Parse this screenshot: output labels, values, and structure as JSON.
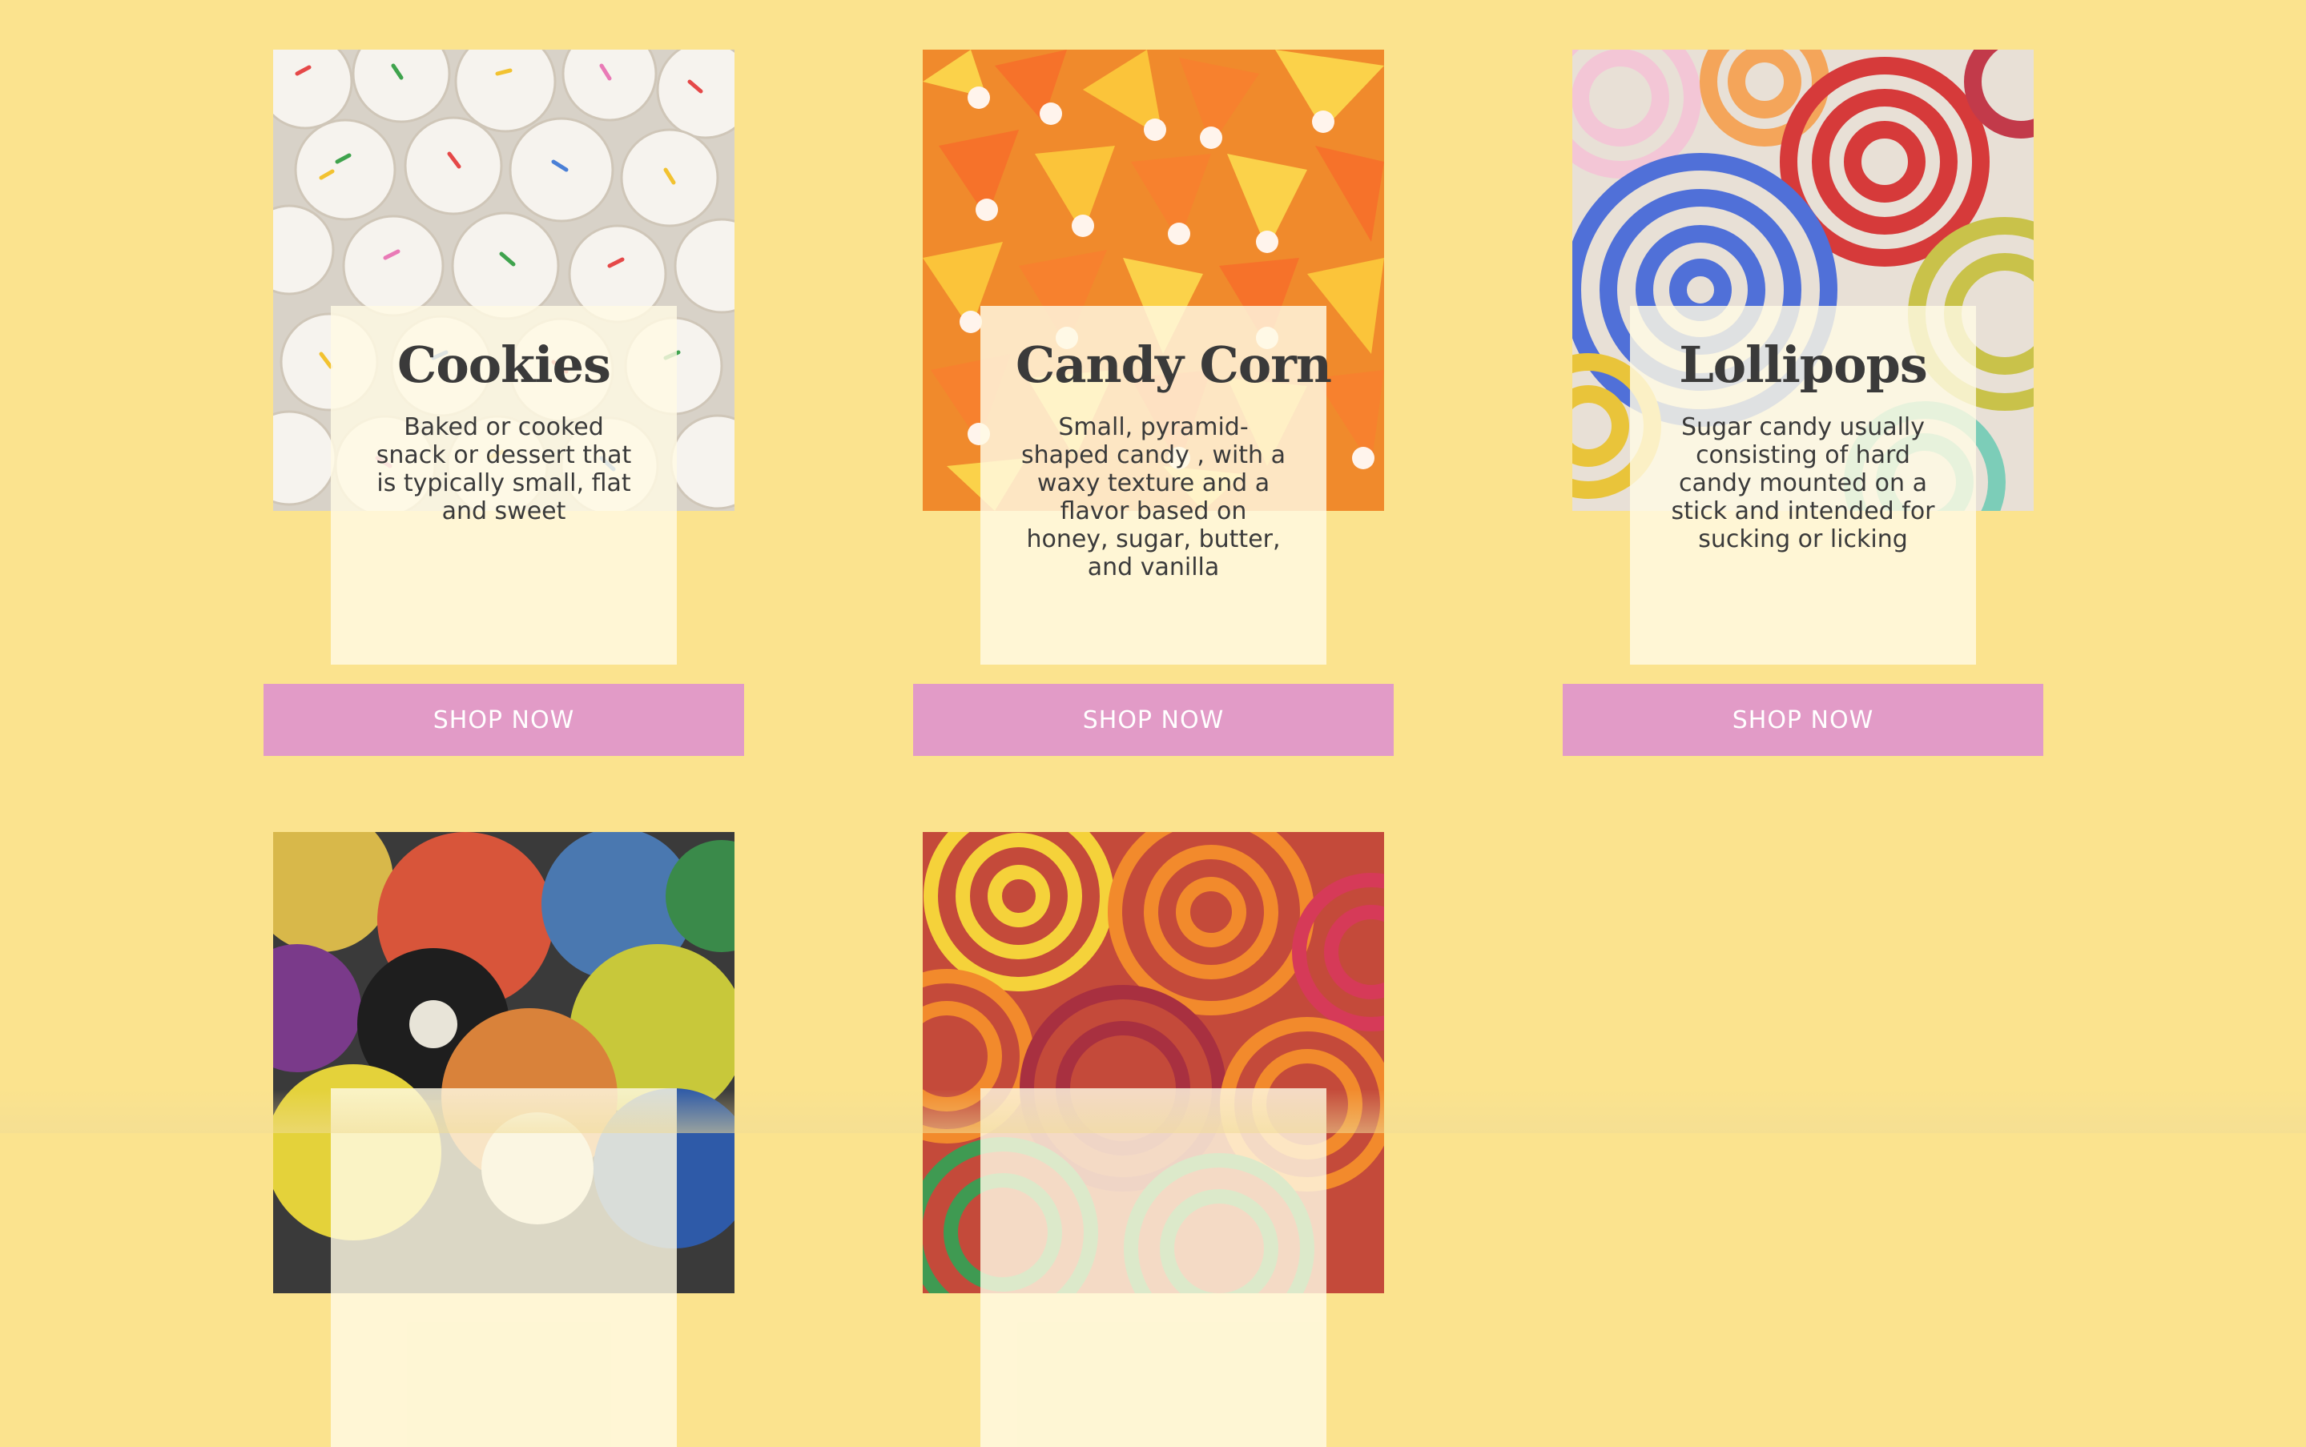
{
  "colors": {
    "background": "#fbe38e",
    "button": "#e29bc7",
    "info_box": "#fffae4",
    "text": "#3a3a3a"
  },
  "products": [
    {
      "title": "Cookies",
      "description": "Baked or cooked snack or dessert that is typically small, flat and sweet",
      "button": "SHOP NOW",
      "image": "frosted-sprinkle-cookies-image"
    },
    {
      "title": "Candy Corn",
      "description": "Small, pyramid-shaped candy , with a waxy texture and a flavor based on honey, sugar, butter, and vanilla",
      "button": "SHOP NOW",
      "image": "candy-corn-image"
    },
    {
      "title": "Lollipops",
      "description": "Sugar candy usually consisting of hard candy mounted on a stick and intended for sucking or licking",
      "button": "SHOP NOW",
      "image": "swirl-lollipops-image"
    },
    {
      "title": "",
      "description": "",
      "button": "",
      "image": "colorful-hard-candy-balls-image"
    },
    {
      "title": "",
      "description": "",
      "button": "",
      "image": "licorice-wheels-image"
    }
  ]
}
